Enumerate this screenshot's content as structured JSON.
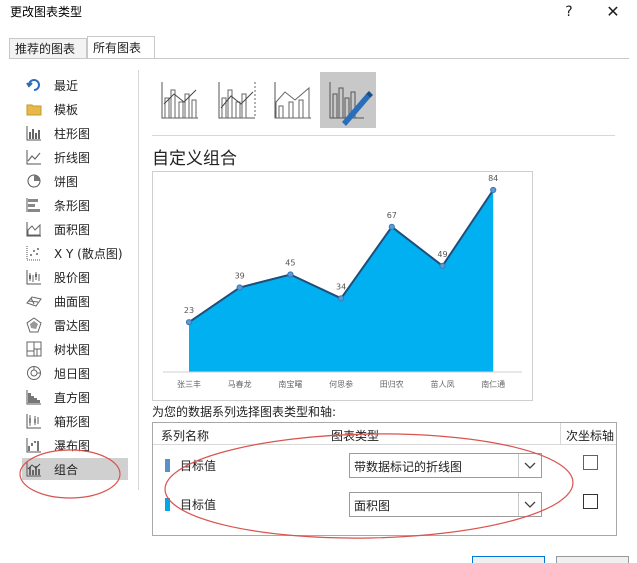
{
  "dialog": {
    "title": "更改图表类型",
    "help": "?",
    "close": "✕"
  },
  "tabs": [
    {
      "label": "推荐的图表",
      "active": false
    },
    {
      "label": "所有图表",
      "active": true
    }
  ],
  "sidebar": {
    "items": [
      {
        "label": "最近",
        "icon": "recent-icon"
      },
      {
        "label": "模板",
        "icon": "folder-icon"
      },
      {
        "label": "柱形图",
        "icon": "column-chart-icon"
      },
      {
        "label": "折线图",
        "icon": "line-chart-icon"
      },
      {
        "label": "饼图",
        "icon": "pie-chart-icon"
      },
      {
        "label": "条形图",
        "icon": "bar-chart-icon"
      },
      {
        "label": "面积图",
        "icon": "area-chart-icon"
      },
      {
        "label": "X Y (散点图)",
        "icon": "scatter-chart-icon"
      },
      {
        "label": "股价图",
        "icon": "stock-chart-icon"
      },
      {
        "label": "曲面图",
        "icon": "surface-chart-icon"
      },
      {
        "label": "雷达图",
        "icon": "radar-chart-icon"
      },
      {
        "label": "树状图",
        "icon": "treemap-chart-icon"
      },
      {
        "label": "旭日图",
        "icon": "sunburst-chart-icon"
      },
      {
        "label": "直方图",
        "icon": "histogram-chart-icon"
      },
      {
        "label": "箱形图",
        "icon": "box-whisker-chart-icon"
      },
      {
        "label": "瀑布图",
        "icon": "waterfall-chart-icon"
      },
      {
        "label": "组合",
        "icon": "combo-chart-icon",
        "selected": true
      }
    ]
  },
  "main": {
    "subtypes": [
      "clustered-column-line-icon",
      "column-line-secondary-axis-icon",
      "stacked-area-column-icon",
      "custom-combo-icon"
    ],
    "selected_subtype": 3,
    "heading": "自定义组合",
    "instruction": "为您的数据系列选择图表类型和轴:",
    "grid": {
      "headers": {
        "series": "系列名称",
        "type": "图表类型",
        "secondary": "次坐标轴"
      },
      "rows": [
        {
          "name": "目标值",
          "chart_type": "带数据标记的折线图",
          "secondary_axis": false,
          "color": "#5b8fc7"
        },
        {
          "name": "目标值",
          "chart_type": "面积图",
          "secondary_axis": false,
          "color": "#00a8e8"
        }
      ]
    }
  },
  "colors": {
    "area": "#00b0f0",
    "line": "#1f4e79",
    "marker": "#5b9bd5",
    "annotation": "#d9534f"
  },
  "chart_data": {
    "type": "area",
    "categories": [
      "张三丰",
      "马春龙",
      "南宝曙",
      "何思参",
      "田归农",
      "苗人凤",
      "南仁通"
    ],
    "series": [
      {
        "name": "目标值",
        "type": "line",
        "values": [
          23,
          39,
          45,
          34,
          67,
          49,
          84
        ]
      },
      {
        "name": "目标值",
        "type": "area",
        "values": [
          23,
          39,
          45,
          34,
          67,
          49,
          84
        ]
      }
    ],
    "data_labels": [
      "23",
      "39",
      "45",
      "34",
      "67",
      "49",
      "84"
    ],
    "ylim": [
      0,
      90
    ],
    "grid": false,
    "legend": "none"
  }
}
